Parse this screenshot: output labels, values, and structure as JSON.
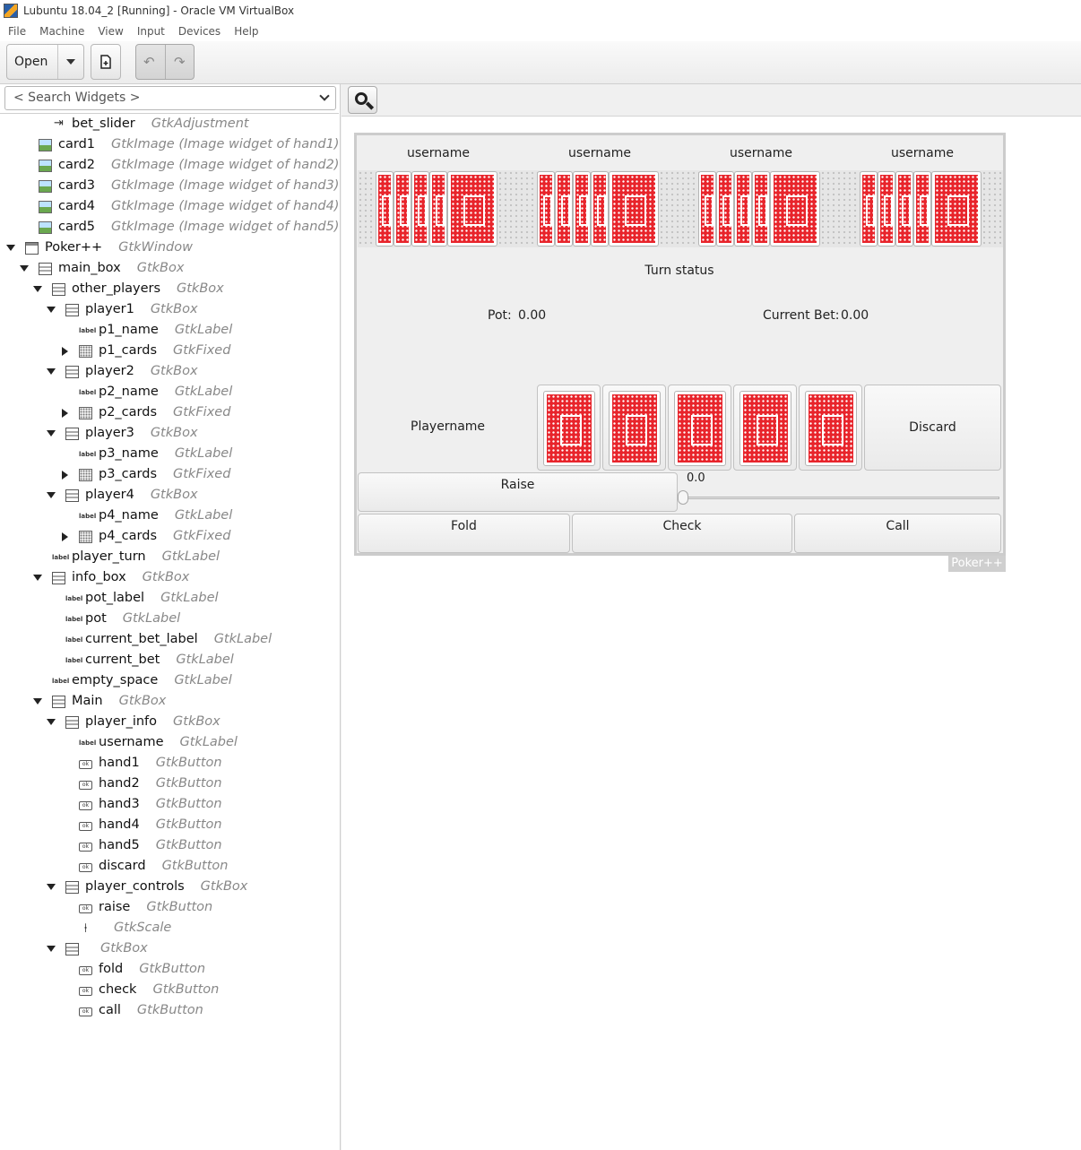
{
  "window": {
    "title": "Lubuntu 18.04_2 [Running] - Oracle VM VirtualBox"
  },
  "menu": [
    "File",
    "Machine",
    "View",
    "Input",
    "Devices",
    "Help"
  ],
  "toolbar": {
    "open_label": "Open",
    "undo_symbol": "↶",
    "redo_symbol": "↷"
  },
  "search": {
    "placeholder": "< Search Widgets >"
  },
  "tree": [
    {
      "depth": 2,
      "exp": "none",
      "icon": "adj",
      "name": "bet_slider",
      "type": "GtkAdjustment"
    },
    {
      "depth": 1,
      "exp": "none",
      "icon": "image",
      "name": "card1",
      "type": "GtkImage  (Image widget of hand1)"
    },
    {
      "depth": 1,
      "exp": "none",
      "icon": "image",
      "name": "card2",
      "type": "GtkImage  (Image widget of hand2)"
    },
    {
      "depth": 1,
      "exp": "none",
      "icon": "image",
      "name": "card3",
      "type": "GtkImage  (Image widget of hand3)"
    },
    {
      "depth": 1,
      "exp": "none",
      "icon": "image",
      "name": "card4",
      "type": "GtkImage  (Image widget of hand4)"
    },
    {
      "depth": 1,
      "exp": "none",
      "icon": "image",
      "name": "card5",
      "type": "GtkImage  (Image widget of hand5)"
    },
    {
      "depth": 0,
      "exp": "open",
      "icon": "window",
      "name": "Poker++",
      "type": "GtkWindow"
    },
    {
      "depth": 1,
      "exp": "open",
      "icon": "box",
      "name": "main_box",
      "type": "GtkBox"
    },
    {
      "depth": 2,
      "exp": "open",
      "icon": "box",
      "name": "other_players",
      "type": "GtkBox"
    },
    {
      "depth": 3,
      "exp": "open",
      "icon": "box",
      "name": "player1",
      "type": "GtkBox"
    },
    {
      "depth": 4,
      "exp": "none",
      "icon": "label",
      "name": "p1_name",
      "type": "GtkLabel"
    },
    {
      "depth": 4,
      "exp": "closed",
      "icon": "fixed",
      "name": "p1_cards",
      "type": "GtkFixed"
    },
    {
      "depth": 3,
      "exp": "open",
      "icon": "box",
      "name": "player2",
      "type": "GtkBox"
    },
    {
      "depth": 4,
      "exp": "none",
      "icon": "label",
      "name": "p2_name",
      "type": "GtkLabel"
    },
    {
      "depth": 4,
      "exp": "closed",
      "icon": "fixed",
      "name": "p2_cards",
      "type": "GtkFixed"
    },
    {
      "depth": 3,
      "exp": "open",
      "icon": "box",
      "name": "player3",
      "type": "GtkBox"
    },
    {
      "depth": 4,
      "exp": "none",
      "icon": "label",
      "name": "p3_name",
      "type": "GtkLabel"
    },
    {
      "depth": 4,
      "exp": "closed",
      "icon": "fixed",
      "name": "p3_cards",
      "type": "GtkFixed"
    },
    {
      "depth": 3,
      "exp": "open",
      "icon": "box",
      "name": "player4",
      "type": "GtkBox"
    },
    {
      "depth": 4,
      "exp": "none",
      "icon": "label",
      "name": "p4_name",
      "type": "GtkLabel"
    },
    {
      "depth": 4,
      "exp": "closed",
      "icon": "fixed",
      "name": "p4_cards",
      "type": "GtkFixed"
    },
    {
      "depth": 2,
      "exp": "none",
      "icon": "label",
      "name": "player_turn",
      "type": "GtkLabel"
    },
    {
      "depth": 2,
      "exp": "open",
      "icon": "box",
      "name": "info_box",
      "type": "GtkBox"
    },
    {
      "depth": 3,
      "exp": "none",
      "icon": "label",
      "name": "pot_label",
      "type": "GtkLabel"
    },
    {
      "depth": 3,
      "exp": "none",
      "icon": "label",
      "name": "pot",
      "type": "GtkLabel"
    },
    {
      "depth": 3,
      "exp": "none",
      "icon": "label",
      "name": "current_bet_label",
      "type": "GtkLabel"
    },
    {
      "depth": 3,
      "exp": "none",
      "icon": "label",
      "name": "current_bet",
      "type": "GtkLabel"
    },
    {
      "depth": 2,
      "exp": "none",
      "icon": "label",
      "name": "empty_space",
      "type": "GtkLabel"
    },
    {
      "depth": 2,
      "exp": "open",
      "icon": "box",
      "name": "Main",
      "type": "GtkBox"
    },
    {
      "depth": 3,
      "exp": "open",
      "icon": "box",
      "name": "player_info",
      "type": "GtkBox"
    },
    {
      "depth": 4,
      "exp": "none",
      "icon": "label",
      "name": "username",
      "type": "GtkLabel"
    },
    {
      "depth": 4,
      "exp": "none",
      "icon": "button",
      "name": "hand1",
      "type": "GtkButton"
    },
    {
      "depth": 4,
      "exp": "none",
      "icon": "button",
      "name": "hand2",
      "type": "GtkButton"
    },
    {
      "depth": 4,
      "exp": "none",
      "icon": "button",
      "name": "hand3",
      "type": "GtkButton"
    },
    {
      "depth": 4,
      "exp": "none",
      "icon": "button",
      "name": "hand4",
      "type": "GtkButton"
    },
    {
      "depth": 4,
      "exp": "none",
      "icon": "button",
      "name": "hand5",
      "type": "GtkButton"
    },
    {
      "depth": 4,
      "exp": "none",
      "icon": "button",
      "name": "discard",
      "type": "GtkButton"
    },
    {
      "depth": 3,
      "exp": "open",
      "icon": "box",
      "name": "player_controls",
      "type": "GtkBox"
    },
    {
      "depth": 4,
      "exp": "none",
      "icon": "button",
      "name": "raise",
      "type": "GtkButton"
    },
    {
      "depth": 4,
      "exp": "none",
      "icon": "scale",
      "name": "",
      "type": "GtkScale"
    },
    {
      "depth": 3,
      "exp": "open",
      "icon": "box",
      "name": "",
      "type": "GtkBox"
    },
    {
      "depth": 4,
      "exp": "none",
      "icon": "button",
      "name": "fold",
      "type": "GtkButton"
    },
    {
      "depth": 4,
      "exp": "none",
      "icon": "button",
      "name": "check",
      "type": "GtkButton"
    },
    {
      "depth": 4,
      "exp": "none",
      "icon": "button",
      "name": "call",
      "type": "GtkButton"
    }
  ],
  "preview": {
    "players": [
      "username",
      "username",
      "username",
      "username"
    ],
    "turn_status": "Turn status",
    "pot_label": "Pot:",
    "pot": "0.00",
    "current_bet_label": "Current Bet:",
    "current_bet": "0.00",
    "player_name": "Playername",
    "discard": "Discard",
    "raise": "Raise",
    "slider_value": "0.0",
    "fold": "Fold",
    "check": "Check",
    "call": "Call",
    "window_tag": "Poker++"
  },
  "colors": {
    "card_back": "#e8242b"
  },
  "icons": {
    "search": "magnifier-icon",
    "new": "new-document-icon"
  }
}
